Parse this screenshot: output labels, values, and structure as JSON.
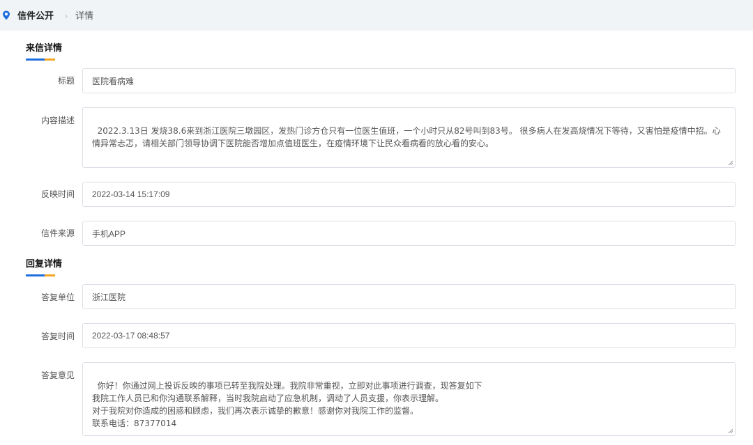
{
  "breadcrumb": {
    "root": "信件公开",
    "separator": "›",
    "current": "详情"
  },
  "letter": {
    "section_title": "来信详情",
    "fields": {
      "title": {
        "label": "标题",
        "value": "医院看病难"
      },
      "content": {
        "label": "内容描述",
        "value": "2022.3.13日 发烧38.6来到浙江医院三墩园区，发热门诊方仓只有一位医生值班，一个小时只从82号叫到83号。 很多病人在发高烧情况下等待，又害怕是疫情中招。心情异常忐忑，请相关部门领导协调下医院能否增加点值班医生，在疫情环境下让民众看病看的放心看的安心。"
      },
      "time": {
        "label": "反映时间",
        "value": "2022-03-14 15:17:09"
      },
      "source": {
        "label": "信件来源",
        "value": "手机APP"
      }
    }
  },
  "reply": {
    "section_title": "回复详情",
    "fields": {
      "unit": {
        "label": "答复单位",
        "value": "浙江医院"
      },
      "time": {
        "label": "答复时间",
        "value": "2022-03-17 08:48:57"
      },
      "opinion": {
        "label": "答复意见",
        "value": "你好！你通过网上投诉反映的事项已转至我院处理。我院非常重视，立即对此事项进行调查，现答复如下\n我院工作人员已和你沟通联系解释，当时我院启动了应急机制，调动了人员支援，你表示理解。\n对于我院对你造成的困惑和顾虑，我们再次表示诚挚的歉意！感谢你对我院工作的监督。\n联系电话：87377014"
      }
    }
  },
  "colors": {
    "accent_blue": "#1f6fe0",
    "accent_orange": "#f5a623",
    "topbar_bg": "#f1f4f7"
  },
  "icons": {
    "breadcrumb_icon": "location-pin-icon"
  }
}
